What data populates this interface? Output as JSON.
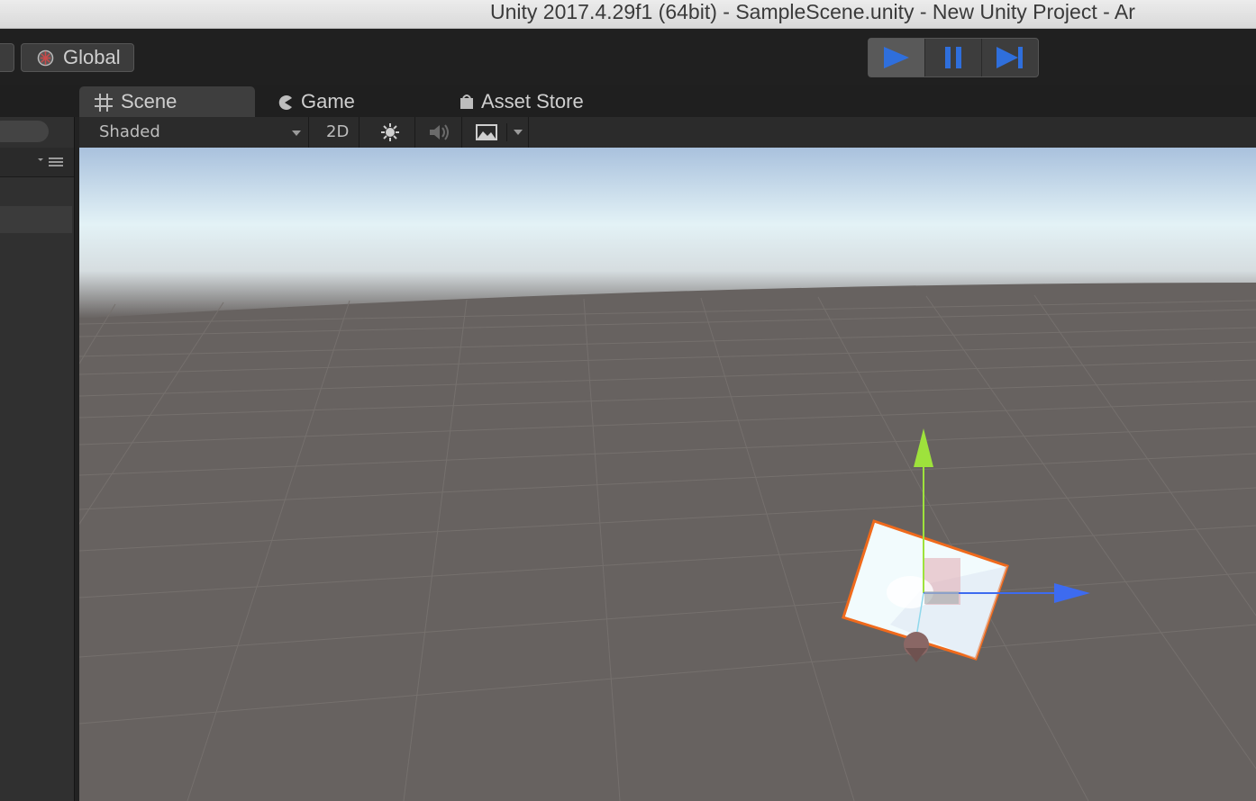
{
  "window": {
    "title": "Unity 2017.4.29f1 (64bit) - SampleScene.unity - New Unity Project - Ar"
  },
  "toolbar": {
    "pivot_space": {
      "label": "Global",
      "icon": "globe-icon"
    },
    "play_controls": [
      {
        "name": "play",
        "icon": "play-icon",
        "active": true
      },
      {
        "name": "pause",
        "icon": "pause-icon",
        "active": false
      },
      {
        "name": "step",
        "icon": "step-icon",
        "active": false
      }
    ],
    "accent_color": "#2f6fdc"
  },
  "tabs": [
    {
      "label": "Scene",
      "icon": "grid-icon",
      "active": true
    },
    {
      "label": "Game",
      "icon": "pacman-icon",
      "active": false
    },
    {
      "label": "Asset Store",
      "icon": "store-icon",
      "active": false
    }
  ],
  "scene_toolbar": {
    "draw_mode": "Shaded",
    "mode_2d": "2D",
    "lighting_icon": "sun-icon",
    "audio_icon": "speaker-icon",
    "effects_icon": "image-icon"
  },
  "left_panel": {
    "lock_icon": "lock-icon",
    "menu_icon": "menu-icon"
  },
  "scene": {
    "sky_colors": [
      "#a9c1dd",
      "#e3f2f6"
    ],
    "ground_color": "#676260",
    "selection_color": "#f06a1c",
    "gizmo_colors": {
      "y_axis": "#9ee23c",
      "x_axis": "#3d6bf0"
    }
  }
}
